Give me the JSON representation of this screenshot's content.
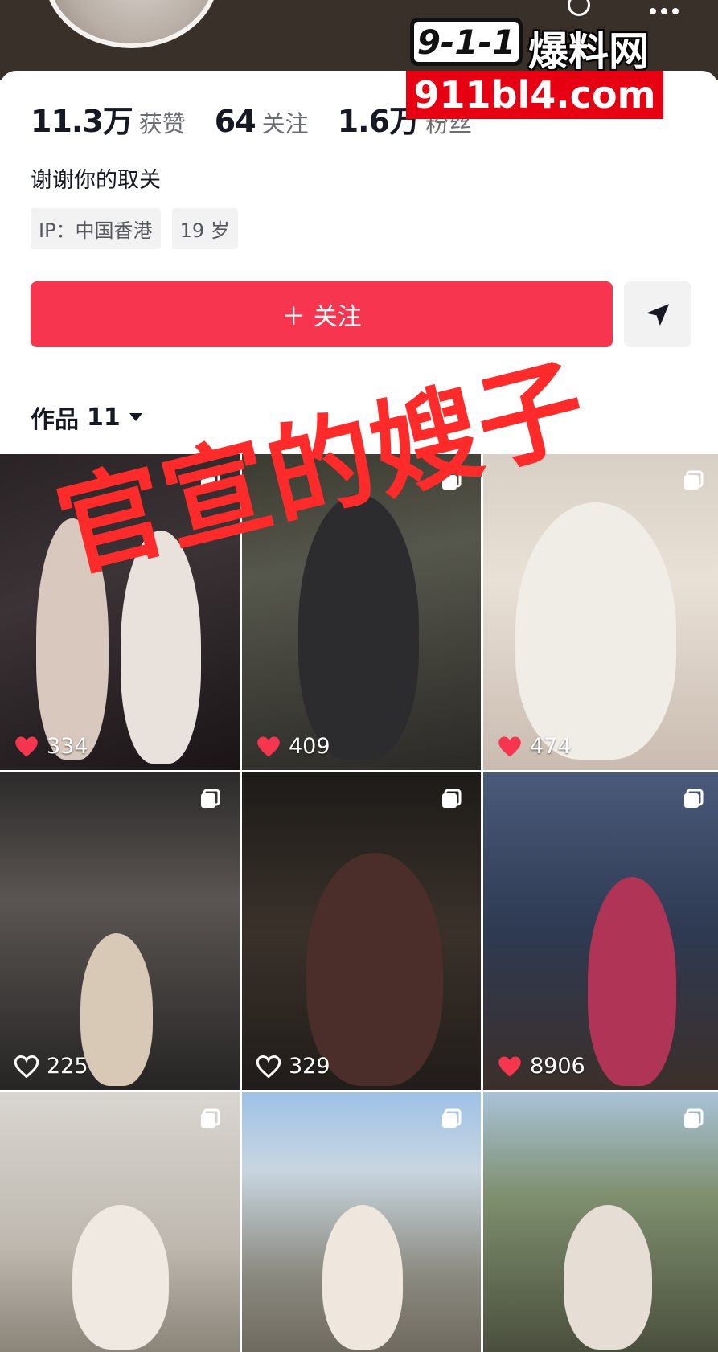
{
  "profile": {
    "stats": [
      {
        "value": "11.3万",
        "label": "获赞"
      },
      {
        "value": "64",
        "label": "关注"
      },
      {
        "value": "1.6万",
        "label": "粉丝"
      }
    ],
    "bio": "谢谢你的取关",
    "tags": [
      "IP：中国香港",
      "19 岁"
    ],
    "follow_label": "＋ 关注",
    "accent": "#f8354f"
  },
  "works": {
    "label": "作品",
    "count": "11",
    "items": [
      {
        "likes": "334",
        "liked": true
      },
      {
        "likes": "409",
        "liked": true
      },
      {
        "likes": "474",
        "liked": true
      },
      {
        "likes": "225",
        "liked": false
      },
      {
        "likes": "329",
        "liked": false
      },
      {
        "likes": "8906",
        "liked": true
      },
      {
        "likes": "",
        "liked": false
      },
      {
        "likes": "",
        "liked": false
      },
      {
        "likes": "",
        "liked": false
      }
    ]
  },
  "watermark": {
    "logo": "9-1-1",
    "brand": "爆料网",
    "domain": "911bl4.com"
  },
  "overlay_caption": "官宣的嫂子"
}
